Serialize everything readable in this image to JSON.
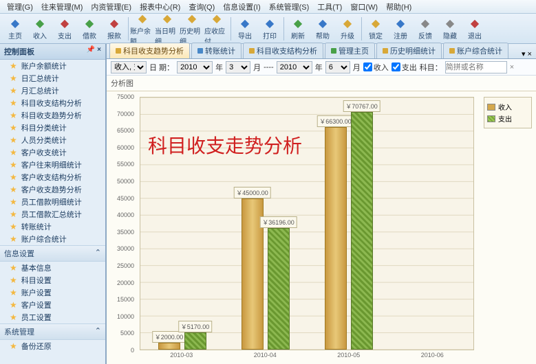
{
  "menu": [
    "管理(G)",
    "往来管理(M)",
    "内资管理(E)",
    "报表中心(R)",
    "查询(Q)",
    "信息设置(I)",
    "系统管理(S)",
    "工具(T)",
    "窗口(W)",
    "帮助(H)"
  ],
  "toolbar": [
    {
      "label": "主页",
      "color": "#3878c8"
    },
    {
      "label": "收入",
      "color": "#48a048"
    },
    {
      "label": "支出",
      "color": "#c04040"
    },
    {
      "label": "借款",
      "color": "#48a048"
    },
    {
      "label": "报款",
      "color": "#c04040"
    },
    {
      "sep": true
    },
    {
      "label": "账户余额",
      "color": "#d8a838"
    },
    {
      "label": "当日明细",
      "color": "#d8a838"
    },
    {
      "label": "历史明细",
      "color": "#d8a838"
    },
    {
      "label": "应收应付",
      "color": "#d8a838"
    },
    {
      "sep": true
    },
    {
      "label": "导出",
      "color": "#3878c8"
    },
    {
      "label": "打印",
      "color": "#3878c8"
    },
    {
      "sep": true
    },
    {
      "label": "刷新",
      "color": "#48a048"
    },
    {
      "label": "帮助",
      "color": "#3878c8"
    },
    {
      "label": "升级",
      "color": "#d8a838"
    },
    {
      "sep": true
    },
    {
      "label": "锁定",
      "color": "#d8a838"
    },
    {
      "label": "注册",
      "color": "#3878c8"
    },
    {
      "label": "反馈",
      "color": "#888"
    },
    {
      "label": "隐藏",
      "color": "#888"
    },
    {
      "label": "退出",
      "color": "#c04040"
    }
  ],
  "sidebar": {
    "title": "控制面板",
    "groups": [
      {
        "name": "",
        "items": [
          "账户余额统计",
          "日汇总统计",
          "月汇总统计",
          "科目收支结构分析",
          "科目收支趋势分析",
          "科目分类统计",
          "人员分类统计",
          "客户收支统计",
          "客户往来明细统计",
          "客户收支结构分析",
          "客户收支趋势分析",
          "员工借款明细统计",
          "员工借款汇总统计",
          "转账统计",
          "账户综合统计"
        ]
      },
      {
        "name": "信息设置",
        "items": [
          "基本信息",
          "科目设置",
          "账户设置",
          "客户设置",
          "员工设置"
        ]
      },
      {
        "name": "系统管理",
        "items": [
          "备份还原"
        ]
      }
    ]
  },
  "tabs": [
    {
      "label": "科目收支趋势分析",
      "active": true,
      "color": "#d8a838"
    },
    {
      "label": "转账统计",
      "color": "#4888c8"
    },
    {
      "label": "科目收支结构分析",
      "color": "#d8a838"
    },
    {
      "label": "管理主页",
      "color": "#48a048"
    },
    {
      "label": "历史明细统计",
      "color": "#d8a838"
    },
    {
      "label": "账户综合统计",
      "color": "#d8a838"
    }
  ],
  "filter": {
    "type_label": "收入, 支出,...",
    "date_label": "日 期：",
    "year1": "2010",
    "unit_y": "年",
    "month1": "3",
    "unit_m": "月",
    "sep": "----",
    "year2": "2010",
    "month2": "6",
    "cb_in": "收入",
    "cb_out": "支出",
    "subject_label": "科目：",
    "search_ph": "简拼或名称"
  },
  "chart_section_title": "分析图",
  "legend": {
    "in": "收入",
    "out": "支出"
  },
  "watermark": "科目收支走势分析",
  "chart_data": {
    "type": "bar",
    "title": "",
    "xlabel": "",
    "ylabel": "",
    "ylim": [
      0,
      75000
    ],
    "ytick": 5000,
    "categories": [
      "2010-03",
      "2010-04",
      "2010-05",
      "2010-06"
    ],
    "series": [
      {
        "name": "收入",
        "values": [
          2000.0,
          45000.0,
          66300.0,
          null
        ]
      },
      {
        "name": "支出",
        "values": [
          5170.0,
          36196.0,
          70767.0,
          null
        ]
      }
    ],
    "value_prefix": "￥"
  }
}
